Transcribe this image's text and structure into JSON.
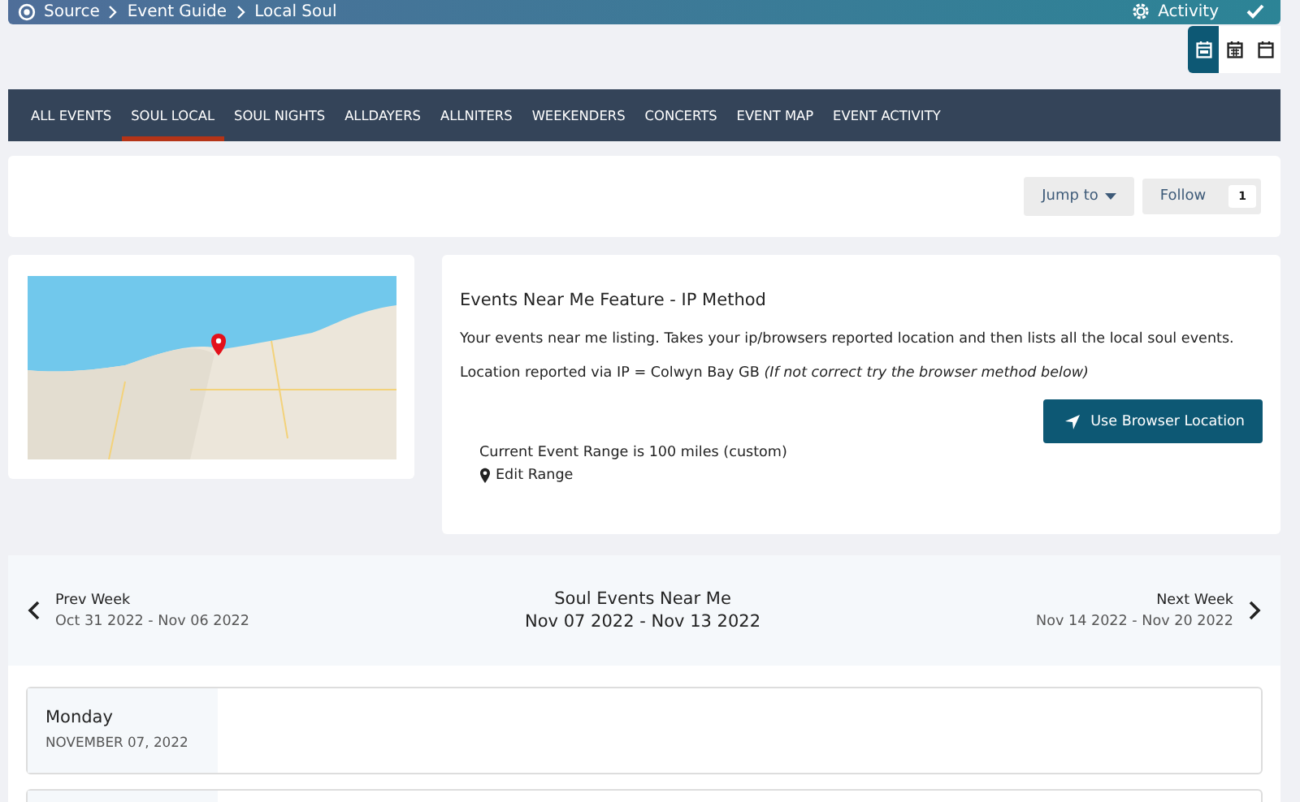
{
  "breadcrumb": [
    {
      "label": "Source"
    },
    {
      "label": "Event Guide"
    },
    {
      "label": "Local Soul"
    }
  ],
  "top_actions": {
    "activity": "Activity"
  },
  "view_buttons": [
    {
      "selected": true
    },
    {
      "selected": false
    },
    {
      "selected": false
    }
  ],
  "tabs": [
    {
      "label": "ALL EVENTS",
      "selected": false
    },
    {
      "label": "SOUL LOCAL",
      "selected": true
    },
    {
      "label": "SOUL NIGHTS",
      "selected": false
    },
    {
      "label": "ALLDAYERS",
      "selected": false
    },
    {
      "label": "ALLNITERS",
      "selected": false
    },
    {
      "label": "WEEKENDERS",
      "selected": false
    },
    {
      "label": "CONCERTS",
      "selected": false
    },
    {
      "label": "EVENT MAP",
      "selected": false
    },
    {
      "label": "EVENT ACTIVITY",
      "selected": false
    }
  ],
  "toolbar": {
    "jump_to": "Jump to",
    "follow": "Follow",
    "follow_count": "1"
  },
  "near_me": {
    "title": "Events Near Me Feature - IP Method",
    "description": "Your events near me listing. Takes your ip/browsers reported location and then lists all the local soul events.",
    "location": "Location reported via IP = Colwyn Bay GB *(If not correct try the browser method below)*",
    "browser_button": "Use Browser Location",
    "range": "Current Event Range is 100 miles (custom)",
    "edit_range": "Edit Range"
  },
  "week_nav": {
    "prev_label": "Prev Week",
    "prev_range": "Oct 31 2022 - Nov 06 2022",
    "title": "Soul Events Near Me",
    "current_range": "Nov 07 2022 - Nov 13 2022",
    "next_label": "Next Week",
    "next_range": "Nov 14 2022 - Nov 20 2022"
  },
  "days": [
    {
      "day": "Monday",
      "date": "NOVEMBER 07, 2022"
    }
  ]
}
